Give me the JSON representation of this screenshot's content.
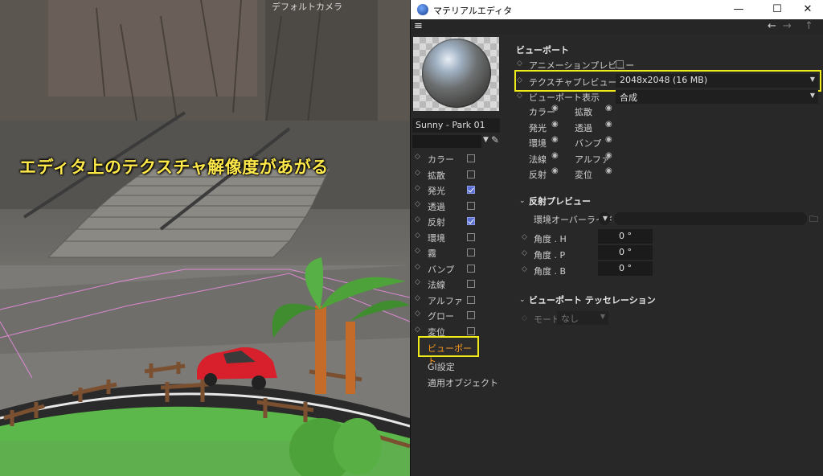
{
  "viewport": {
    "camera_label": "デフォルトカメラ",
    "caption": "エディタ上のテクスチャ解像度があがる"
  },
  "window": {
    "title": "マテリアルエディタ",
    "minimize": "—",
    "maximize": "☐",
    "close": "✕"
  },
  "toolbar": {
    "menu_icon": "≡",
    "back": "←",
    "forward": "→",
    "up": "↑"
  },
  "material": {
    "name": "Sunny - Park 01"
  },
  "channels": [
    {
      "label": "カラー",
      "checked": false
    },
    {
      "label": "拡散",
      "checked": false
    },
    {
      "label": "発光",
      "checked": true
    },
    {
      "label": "透過",
      "checked": false
    },
    {
      "label": "反射",
      "checked": true
    },
    {
      "label": "環境",
      "checked": false
    },
    {
      "label": "霧",
      "checked": false
    },
    {
      "label": "バンプ",
      "checked": false
    },
    {
      "label": "法線",
      "checked": false
    },
    {
      "label": "アルファ",
      "checked": false
    },
    {
      "label": "グロー",
      "checked": false
    },
    {
      "label": "変位",
      "checked": false
    }
  ],
  "nav_items": {
    "viewport": "ビューポート",
    "gi": "GI設定",
    "assign": "適用オブジェクト"
  },
  "viewport_section": {
    "title": "ビューポート",
    "animation_preview_label": "アニメーションプレビュー",
    "texture_preview_size_label": "テクスチャプレビューサイズ",
    "texture_preview_size_value": "2048x2048 (16 MB)",
    "viewport_display_label": "ビューポート表示",
    "viewport_display_value": "合成",
    "display_channels": [
      {
        "label": "カラー"
      },
      {
        "label": "拡散"
      },
      {
        "label": "発光"
      },
      {
        "label": "透過"
      },
      {
        "label": "環境"
      },
      {
        "label": "バンプ"
      },
      {
        "label": "法線"
      },
      {
        "label": "アルファ"
      },
      {
        "label": "反射"
      },
      {
        "label": "変位"
      }
    ]
  },
  "reflection_preview": {
    "title": "反射プレビュー",
    "env_override_label": "環境オーバーライド",
    "angle_h_label": "角度 . H",
    "angle_h_value": "0 °",
    "angle_p_label": "角度 . P",
    "angle_p_value": "0 °",
    "angle_b_label": "角度 . B",
    "angle_b_value": "0 °"
  },
  "tessellation": {
    "title": "ビューポート テッセレーション",
    "mode_label": "モード",
    "mode_value": "なし"
  },
  "colors": {
    "highlight": "#f0ec1a",
    "caption": "#ffe94a",
    "active_tab_text": "#ff9a1f",
    "checkbox_on": "#5a6fd4"
  }
}
